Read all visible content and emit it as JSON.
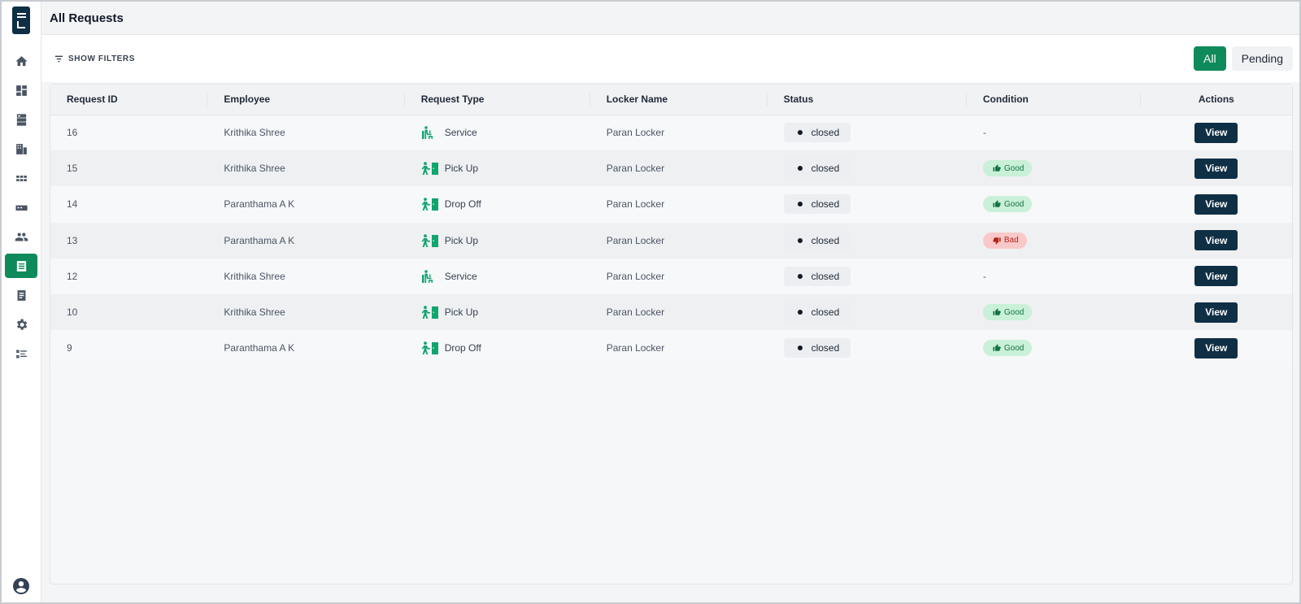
{
  "header": {
    "title": "All Requests"
  },
  "sidebar": {
    "items": [
      {
        "icon": "home-icon"
      },
      {
        "icon": "dashboard-icon"
      },
      {
        "icon": "storage-icon"
      },
      {
        "icon": "buildings-icon"
      },
      {
        "icon": "grid-icon"
      },
      {
        "icon": "card-icon"
      },
      {
        "icon": "users-icon"
      },
      {
        "icon": "requests-icon",
        "active": true
      },
      {
        "icon": "document-icon"
      },
      {
        "icon": "settings-icon"
      },
      {
        "icon": "list-icon"
      }
    ],
    "profile_icon": "account-circle-icon"
  },
  "toolbar": {
    "filters_label": "SHOW FILTERS",
    "tabs": [
      {
        "label": "All",
        "selected": true
      },
      {
        "label": "Pending",
        "selected": false
      }
    ]
  },
  "table": {
    "columns": [
      "Request ID",
      "Employee",
      "Request Type",
      "Locker Name",
      "Status",
      "Condition",
      "Actions"
    ],
    "action_label": "View",
    "rows": [
      {
        "id": "16",
        "employee": "Krithika Shree",
        "type": "Service",
        "type_icon": "service-icon",
        "locker": "Paran Locker",
        "status": "closed",
        "condition": "-"
      },
      {
        "id": "15",
        "employee": "Krithika Shree",
        "type": "Pick Up",
        "type_icon": "locker-person-icon",
        "locker": "Paran Locker",
        "status": "closed",
        "condition": "Good"
      },
      {
        "id": "14",
        "employee": "Paranthama A K",
        "type": "Drop Off",
        "type_icon": "locker-person-icon",
        "locker": "Paran Locker",
        "status": "closed",
        "condition": "Good"
      },
      {
        "id": "13",
        "employee": "Paranthama A K",
        "type": "Pick Up",
        "type_icon": "locker-person-icon",
        "locker": "Paran Locker",
        "status": "closed",
        "condition": "Bad"
      },
      {
        "id": "12",
        "employee": "Krithika Shree",
        "type": "Service",
        "type_icon": "service-icon",
        "locker": "Paran Locker",
        "status": "closed",
        "condition": "-"
      },
      {
        "id": "10",
        "employee": "Krithika Shree",
        "type": "Pick Up",
        "type_icon": "locker-person-icon",
        "locker": "Paran Locker",
        "status": "closed",
        "condition": "Good"
      },
      {
        "id": "9",
        "employee": "Paranthama A K",
        "type": "Drop Off",
        "type_icon": "locker-person-icon",
        "locker": "Paran Locker",
        "status": "closed",
        "condition": "Good"
      }
    ]
  },
  "colors": {
    "accent": "#0f8a5a",
    "navy": "#0f2f45",
    "good_bg": "#c9f0d8",
    "bad_bg": "#f9c9c9"
  }
}
